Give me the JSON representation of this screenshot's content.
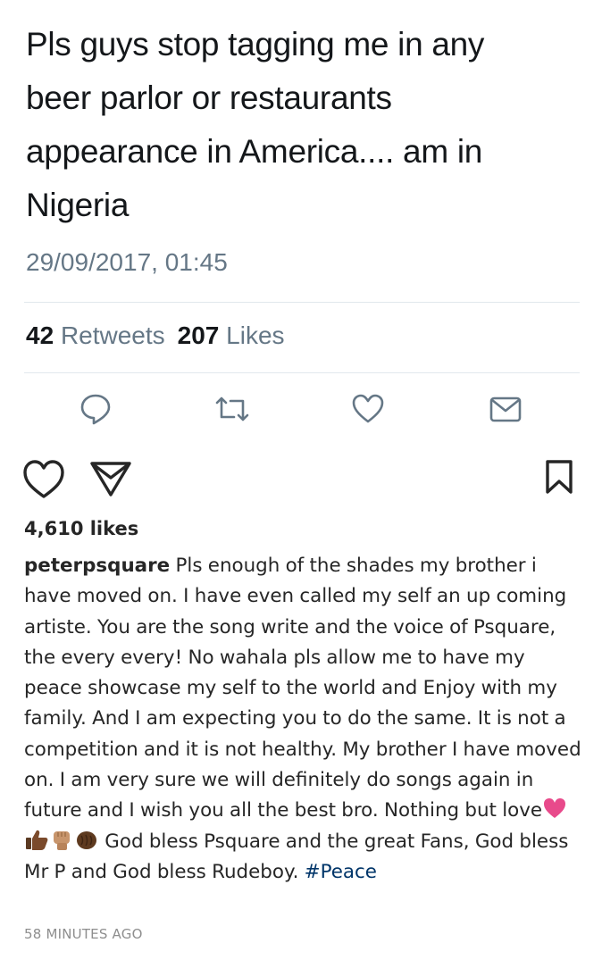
{
  "tweet": {
    "text_lines": [
      "Pls guys stop tagging me in any",
      "beer parlor or restaurants",
      "appearance in America.... am in",
      "Nigeria"
    ],
    "timestamp": "29/09/2017, 01:45",
    "retweets_count": "42",
    "retweets_label": "Retweets",
    "likes_count": "207",
    "likes_label": "Likes",
    "actions": [
      "reply-icon",
      "retweet-icon",
      "like-icon",
      "direct-message-icon"
    ],
    "icon_color": "#657786"
  },
  "post": {
    "actions": [
      "heart-icon",
      "share-icon",
      "bookmark-icon"
    ],
    "likes_text": "4,610 likes",
    "username": "peterpsquare",
    "caption_part1": "Pls enough of the shades my brother i have moved on. I have even called my self an up coming artiste. You are the song write and the voice of Psquare, the every every! No wahala pls allow me to have my peace showcase my self to the world and Enjoy with my family. And I am expecting you to do the same. It is not a competition and it is not healthy. My brother I have moved on. I am very sure we will definitely do songs again in future and I wish you all the best bro. Nothing but love",
    "caption_emojis": [
      "pink-heart-emoji",
      "thumbs-up-emoji",
      "raised-fist-emoji",
      "oncoming-fist-emoji"
    ],
    "caption_part2": " God bless Psquare and the great Fans, God bless Mr P and God bless Rudeboy. ",
    "hashtag": "#Peace",
    "hashtag_color": "#003569",
    "time_ago": "58 MINUTES AGO"
  }
}
